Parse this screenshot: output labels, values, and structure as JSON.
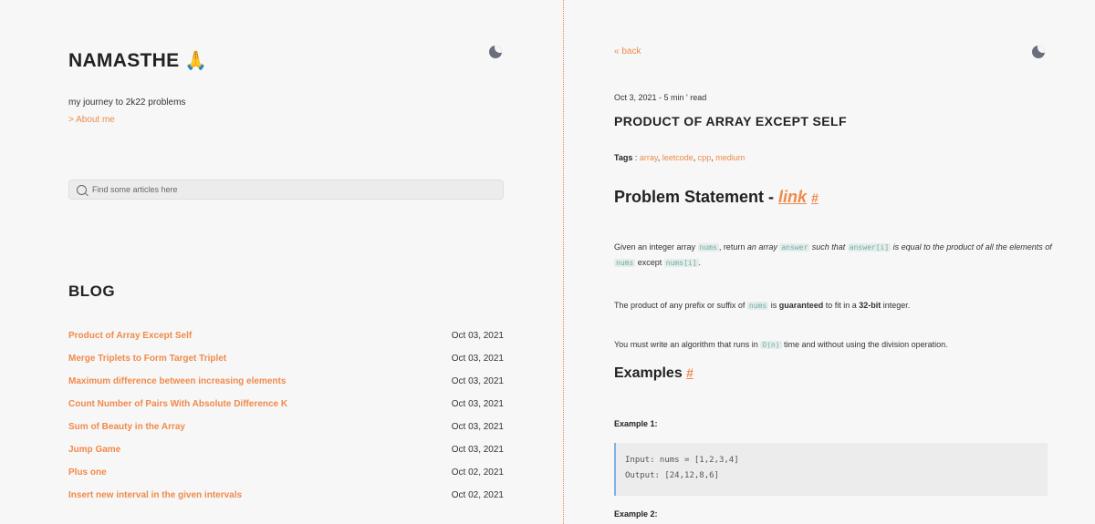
{
  "site": {
    "title": "NAMASTHE",
    "emoji": "🙏",
    "tagline": "my journey to 2k22 problems",
    "about_link": "> About me"
  },
  "search": {
    "placeholder": "Find some articles here"
  },
  "blog": {
    "heading": "BLOG",
    "items": [
      {
        "title": "Product of Array Except Self",
        "date": "Oct 03, 2021"
      },
      {
        "title": "Merge Triplets to Form Target Triplet",
        "date": "Oct 03, 2021"
      },
      {
        "title": "Maximum difference between increasing elements",
        "date": "Oct 03, 2021"
      },
      {
        "title": "Count Number of Pairs With Absolute Difference K",
        "date": "Oct 03, 2021"
      },
      {
        "title": "Sum of Beauty in the Array",
        "date": "Oct 03, 2021"
      },
      {
        "title": "Jump Game",
        "date": "Oct 03, 2021"
      },
      {
        "title": "Plus one",
        "date": "Oct 02, 2021"
      },
      {
        "title": "Insert new interval in the given intervals",
        "date": "Oct 02, 2021"
      }
    ]
  },
  "post": {
    "back": "« back",
    "meta": "Oct 3, 2021 - 5 min ' read",
    "title": "PRODUCT OF ARRAY EXCEPT SELF",
    "tags_label": "Tags",
    "tags": [
      "array",
      "leetcode",
      "cpp",
      "medium"
    ],
    "problem_heading": "Problem Statement - ",
    "problem_link": "link",
    "hash": "#",
    "p1": {
      "t1": "Given an integer array ",
      "c1": "nums",
      "t2": ", return ",
      "i1": "an array ",
      "c2": "answer",
      "i2": " such that ",
      "c3": "answer[i]",
      "i3": " is equal to the product of all the elements of ",
      "c4": "nums",
      "t3": " except ",
      "c5": "nums[i]",
      "t4": "."
    },
    "p2": {
      "t1": "The product of any prefix or suffix of ",
      "c1": "nums",
      "t2": " is ",
      "b1": "guaranteed",
      "t3": " to fit in a ",
      "b2": "32-bit",
      "t4": " integer."
    },
    "p3": {
      "t1": "You must write an algorithm that runs in ",
      "c1": "O(n)",
      "t2": " time and without using the division operation."
    },
    "examples_heading": "Examples",
    "example1_label": "Example 1",
    "example1_code": "Input: nums = [1,2,3,4]\nOutput: [24,12,8,6]",
    "example2_label": "Example 2"
  },
  "colors": {
    "accent": "#f08a4b",
    "moon": "#6b6f7c",
    "code": "#6bb0a0"
  }
}
